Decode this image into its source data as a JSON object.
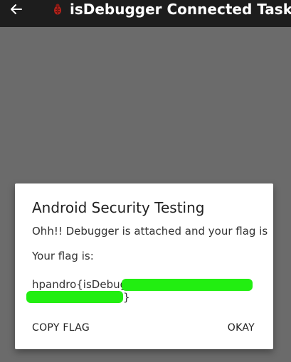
{
  "app_bar": {
    "title": "isDebugger Connected Task",
    "back_icon": "arrow-left-icon",
    "app_icon": "bug-icon",
    "background": "#1d1d1d"
  },
  "dialog": {
    "title": "Android Security Testing",
    "message": "Ohh!! Debugger is attached and your flag is",
    "flag_label": "Your flag is:",
    "flag_prefix": "hpandro{isDebug",
    "flag_suffix": "}",
    "redaction_color": "#22ee11",
    "buttons": {
      "copy": "COPY FLAG",
      "okay": "OKAY"
    }
  },
  "scrim_color": "#6b6b6b"
}
